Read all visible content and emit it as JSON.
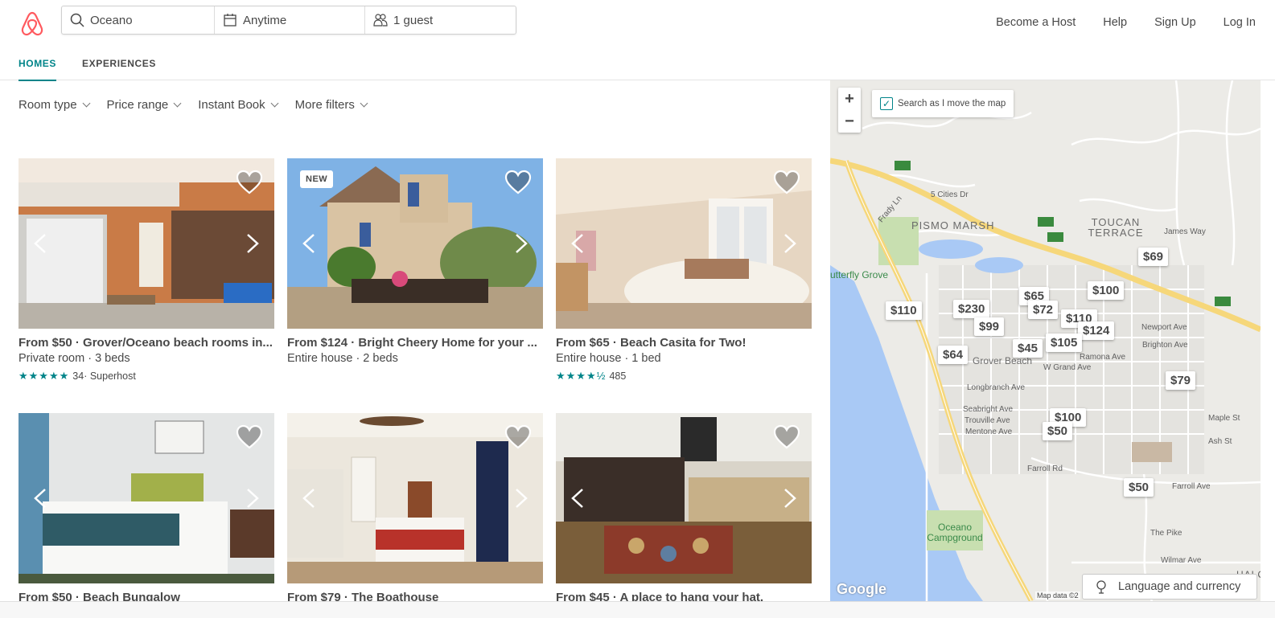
{
  "header": {
    "search": {
      "location": "Oceano",
      "dates": "Anytime",
      "guests": "1 guest"
    },
    "nav": [
      "Become a Host",
      "Help",
      "Sign Up",
      "Log In"
    ],
    "tabs": [
      "HOMES",
      "EXPERIENCES"
    ]
  },
  "filters": [
    "Room type",
    "Price range",
    "Instant Book",
    "More filters"
  ],
  "listings": [
    {
      "title": "From $50 · Grover/Oceano beach rooms in...",
      "subtitle": "Private room · 3 beds",
      "stars": "★★★★★",
      "rating_count": "34",
      "rating_extra": " · Superhost",
      "badge": ""
    },
    {
      "title": "From $124 · Bright Cheery Home for your ...",
      "subtitle": "Entire house · 2 beds",
      "stars": "",
      "rating_count": "",
      "rating_extra": "",
      "badge": "NEW"
    },
    {
      "title": "From $65 · Beach Casita for Two!",
      "subtitle": "Entire house · 1 bed",
      "stars": "★★★★½",
      "rating_count": "485",
      "rating_extra": "",
      "badge": ""
    },
    {
      "title": "From $50 · Beach Bungalow",
      "subtitle": "",
      "stars": "",
      "rating_count": "",
      "rating_extra": "",
      "badge": ""
    },
    {
      "title": "From $79 · The Boathouse",
      "subtitle": "",
      "stars": "",
      "rating_count": "",
      "rating_extra": "",
      "badge": ""
    },
    {
      "title": "From $45 · A place to hang your hat.",
      "subtitle": "",
      "stars": "",
      "rating_count": "",
      "rating_extra": "",
      "badge": ""
    }
  ],
  "map": {
    "search_as_move": "Search as I move the map",
    "zoom_in": "+",
    "zoom_out": "−",
    "prices": [
      "$69",
      "$65",
      "$100",
      "$110",
      "$230",
      "$72",
      "$110",
      "$99",
      "$124",
      "$45",
      "$105",
      "$64",
      "$79",
      "$100",
      "$50",
      "$50"
    ],
    "labels": {
      "pismo_marsh": "PISMO MARSH",
      "toucan_terrace": "TOUCAN TERRACE",
      "butterfly_grove": "utterfly Grove",
      "grover_beach": "Grover Beach",
      "oceano_campground": "Oceano Campground",
      "five_cities": "5 Cities Dr",
      "james_way": "James Way",
      "w_grand": "W Grand Ave",
      "farroll_rd": "Farroll Rd",
      "farroll_ave": "Farroll Ave",
      "the_pike": "The Pike",
      "halcyon": "HALCY",
      "newport": "Newport Ave",
      "brighton": "Brighton Ave",
      "ramona": "Ramona Ave",
      "longbranch": "Longbranch Ave",
      "seabright": "Seabright Ave",
      "trouville": "Trouville Ave",
      "mentone": "Mentone Ave",
      "maple": "Maple St",
      "ash": "Ash St",
      "wilmar": "Wilmar Ave",
      "frady": "Frady Ln"
    },
    "google": "Google",
    "map_data": "Map data ©2"
  },
  "language_button": "Language and currency",
  "colors": {
    "brand": "#FF5A5F",
    "teal": "#008489",
    "text": "#484848"
  }
}
